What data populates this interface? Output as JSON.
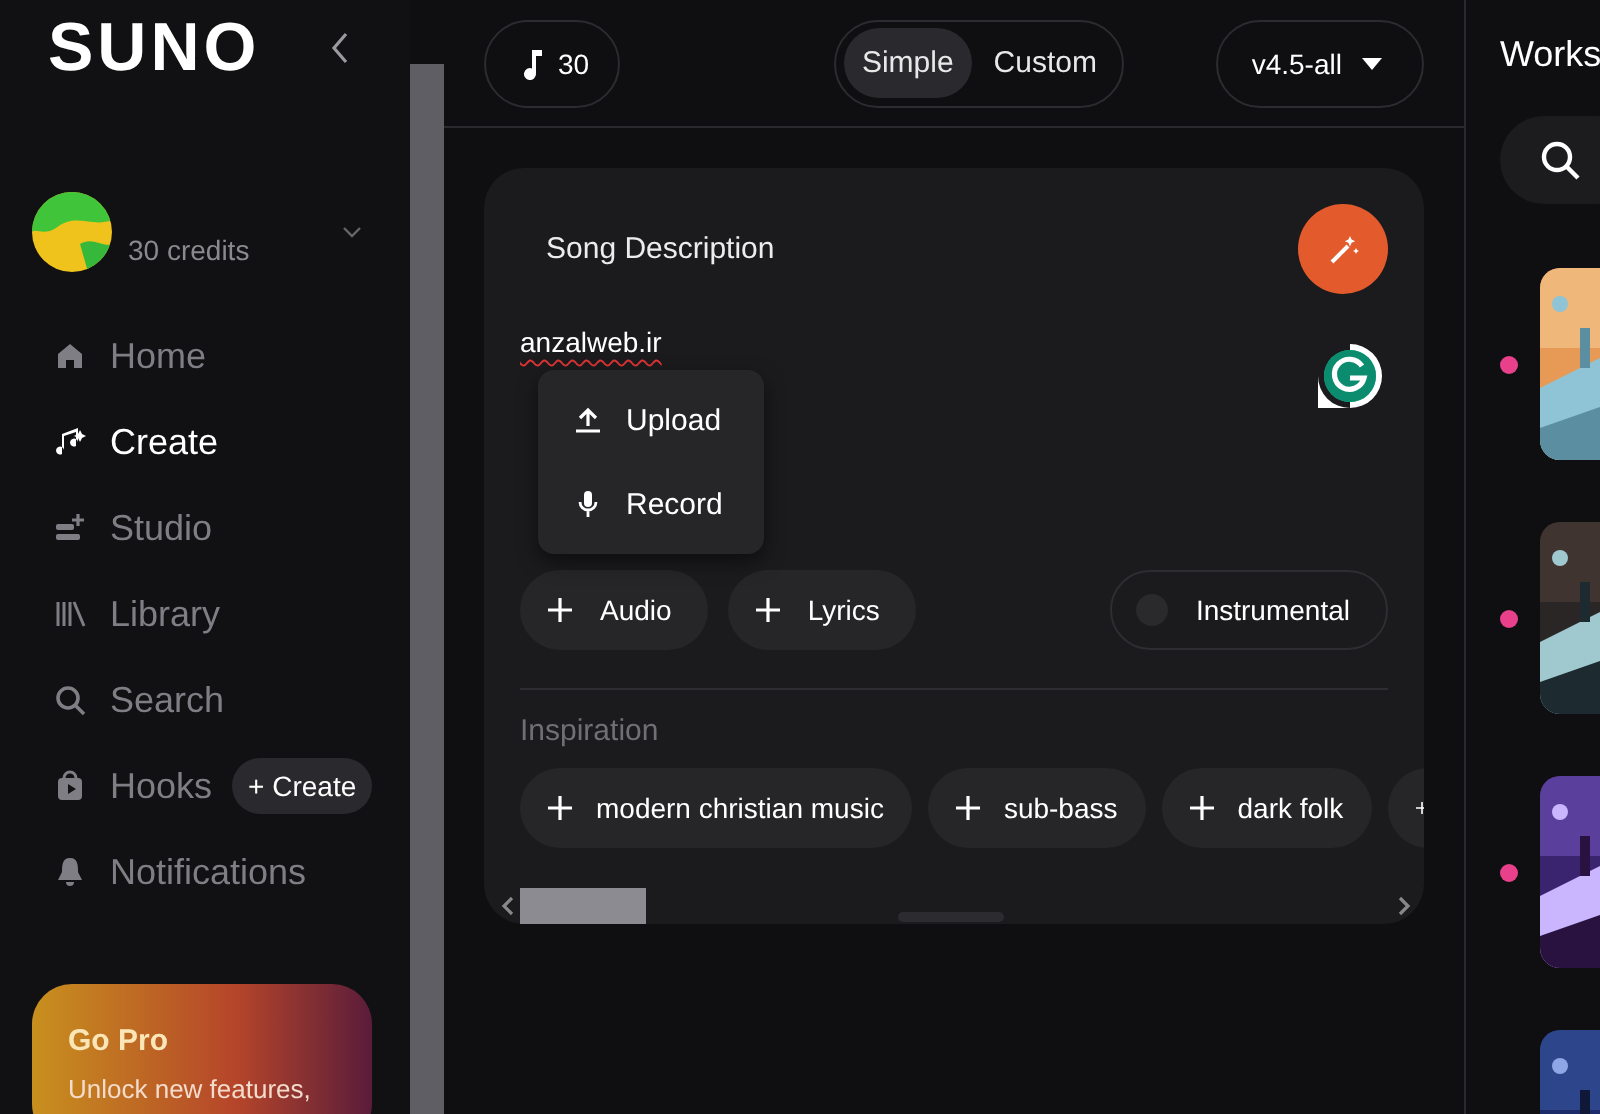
{
  "sidebar": {
    "logo": "SUNO",
    "credits": "30 credits",
    "nav": [
      {
        "label": "Home",
        "kind": "home",
        "selected": false
      },
      {
        "label": "Create",
        "kind": "create",
        "selected": true
      },
      {
        "label": "Studio",
        "kind": "studio",
        "selected": false
      },
      {
        "label": "Library",
        "kind": "library",
        "selected": false
      },
      {
        "label": "Search",
        "kind": "search",
        "selected": false
      },
      {
        "label": "Hooks",
        "kind": "hooks",
        "selected": false,
        "action": "+ Create"
      },
      {
        "label": "Notifications",
        "kind": "bell",
        "selected": false
      }
    ],
    "promo": {
      "title": "Go Pro",
      "text": "Unlock new features,"
    }
  },
  "header": {
    "credits": "30",
    "modes": [
      {
        "label": "Simple",
        "selected": true
      },
      {
        "label": "Custom",
        "selected": false
      }
    ],
    "model": "v4.5-all"
  },
  "composer": {
    "title": "Song Description",
    "value": "anzalweb.ir",
    "menu": [
      {
        "label": "Upload",
        "kind": "upload"
      },
      {
        "label": "Record",
        "kind": "mic"
      }
    ],
    "chips": [
      "Audio",
      "Lyrics"
    ],
    "instrumental": {
      "label": "Instrumental",
      "on": false
    },
    "inspiration_title": "Inspiration",
    "tags": [
      "modern christian music",
      "sub-bass",
      "dark folk"
    ]
  },
  "workspace": {
    "title": "Works",
    "items": [
      {
        "kind": "picture",
        "dot": true
      },
      {
        "kind": "picture",
        "dot": true
      },
      {
        "kind": "picture",
        "dot": true
      },
      {
        "kind": "picture",
        "dot": false
      }
    ]
  }
}
